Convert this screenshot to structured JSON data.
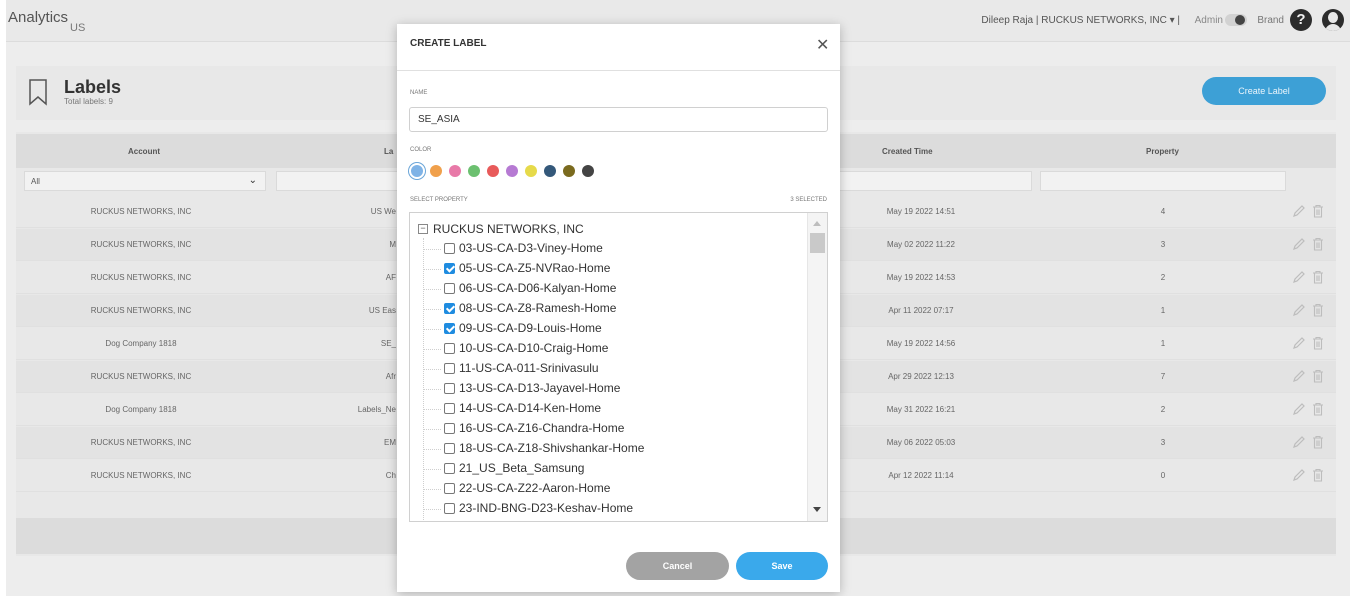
{
  "header": {
    "brand": "Analytics",
    "brand_sub": "US",
    "user_info": "Dileep Raja | RUCKUS NETWORKS, INC ▾ |",
    "admin_label": "Admin",
    "brand_label": "Brand",
    "help_glyph": "?"
  },
  "page": {
    "title": "Labels",
    "subtitle": "Total labels: 9",
    "create_button": "Create Label"
  },
  "table": {
    "headers": [
      "Account",
      "La",
      "Created Time",
      "Property"
    ],
    "filter_value": "All",
    "rows": [
      {
        "account": "RUCKUS NETWORKS, INC",
        "label": "US We",
        "created": "May 19 2022 14:51",
        "property": "4"
      },
      {
        "account": "RUCKUS NETWORKS, INC",
        "label": "M",
        "created": "May 02 2022 11:22",
        "property": "3"
      },
      {
        "account": "RUCKUS NETWORKS, INC",
        "label": "AF",
        "created": "May 19 2022 14:53",
        "property": "2"
      },
      {
        "account": "RUCKUS NETWORKS, INC",
        "label": "US Eas",
        "created": "Apr 11 2022 07:17",
        "property": "1"
      },
      {
        "account": "Dog Company 1818",
        "label": "SE_",
        "created": "May 19 2022 14:56",
        "property": "1"
      },
      {
        "account": "RUCKUS NETWORKS, INC",
        "label": "Afr",
        "created": "Apr 29 2022 12:13",
        "property": "7"
      },
      {
        "account": "Dog Company 1818",
        "label": "Labels_Ne",
        "created": "May 31 2022 16:21",
        "property": "2"
      },
      {
        "account": "RUCKUS NETWORKS, INC",
        "label": "EM",
        "created": "May 06 2022 05:03",
        "property": "3"
      },
      {
        "account": "RUCKUS NETWORKS, INC",
        "label": "Ch",
        "created": "Apr 12 2022 11:14",
        "property": "0"
      }
    ]
  },
  "modal": {
    "title": "CREATE LABEL",
    "name_label": "NAME",
    "name_value": "SE_ASIA",
    "color_label": "COLOR",
    "colors": [
      "#7fb3e6",
      "#f0a04b",
      "#e879a8",
      "#6cc070",
      "#e85a5a",
      "#b67ad3",
      "#e6da4a",
      "#34587a",
      "#7a6a1e",
      "#444444"
    ],
    "selected_color": "#7fb3e6",
    "property_label": "SELECT PROPERTY",
    "selected_count": "3 SELECTED",
    "tree": {
      "root_label": "RUCKUS NETWORKS, INC",
      "root_toggle": "−",
      "items": [
        {
          "label": "03-US-CA-D3-Viney-Home",
          "checked": false
        },
        {
          "label": "05-US-CA-Z5-NVRao-Home",
          "checked": true
        },
        {
          "label": "06-US-CA-D06-Kalyan-Home",
          "checked": false
        },
        {
          "label": "08-US-CA-Z8-Ramesh-Home",
          "checked": true
        },
        {
          "label": "09-US-CA-D9-Louis-Home",
          "checked": true
        },
        {
          "label": "10-US-CA-D10-Craig-Home",
          "checked": false
        },
        {
          "label": "11-US-CA-011-Srinivasulu",
          "checked": false
        },
        {
          "label": "13-US-CA-D13-Jayavel-Home",
          "checked": false
        },
        {
          "label": "14-US-CA-D14-Ken-Home",
          "checked": false
        },
        {
          "label": "16-US-CA-Z16-Chandra-Home",
          "checked": false
        },
        {
          "label": "18-US-CA-Z18-Shivshankar-Home",
          "checked": false
        },
        {
          "label": "21_US_Beta_Samsung",
          "checked": false
        },
        {
          "label": "22-US-CA-Z22-Aaron-Home",
          "checked": false
        },
        {
          "label": "23-IND-BNG-D23-Keshav-Home",
          "checked": false
        }
      ]
    },
    "cancel_label": "Cancel",
    "save_label": "Save"
  }
}
